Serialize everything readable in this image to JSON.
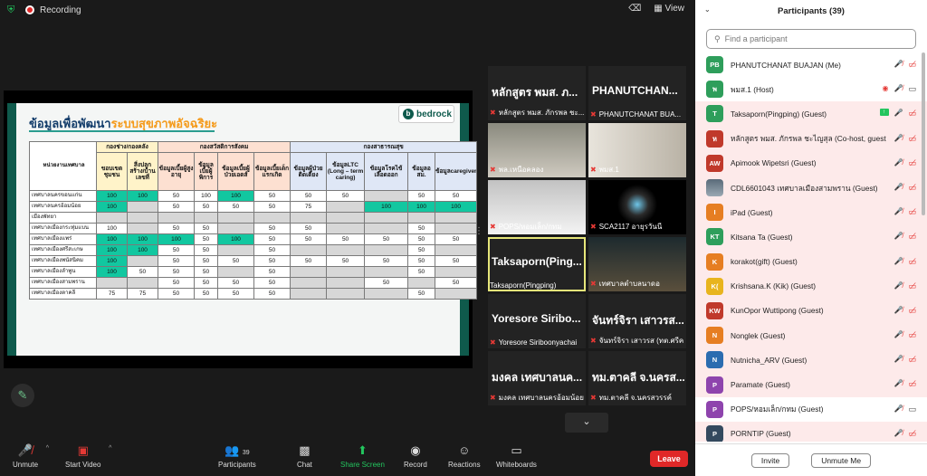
{
  "topbar": {
    "recording_label": "Recording",
    "view_label": "View"
  },
  "slide": {
    "title_part1": "ข้อมูลเพื่อพัฒนา",
    "title_part2": "ระบบสุขภาพอัจฉริยะ",
    "logo_text": "bedrock",
    "header_org": "หน่วยงานเทศบาล",
    "group_a": "กองช่าง/กองคลัง",
    "group_b": "กองสวัสดิการสังคม",
    "group_c": "กองสาธารณสุข",
    "columns": [
      "ขอบเขตชุมชน",
      "สิ่งปลูกสร้าง/บ้านเลขที่",
      "ข้อมูลเบี้ยผู้สูงอายุ",
      "ข้อมูลเบี้ยผู้พิการ",
      "ข้อมูลเบี้ยผู้ป่วยเอดส์",
      "ข้อมูลเบี้ยเด็กแรกเกิด",
      "ข้อมูลผู้ป่วยติดเตียง",
      "ข้อมูลLTC (Long – term caring)",
      "ข้อมูลโรคไข้เลือดออก",
      "ข้อมูลอสม.",
      "ข้อมูลcaregiver"
    ],
    "rows": [
      {
        "org": "เทศบาลนครขอนแก่น",
        "cells": [
          "100",
          "100",
          "50",
          "100",
          "100",
          "50",
          "50",
          "50",
          "",
          "50",
          "50"
        ]
      },
      {
        "org": "เทศบาลนครอ้อมน้อย",
        "cells": [
          "100",
          "",
          "50",
          "50",
          "50",
          "50",
          "75",
          "",
          "100",
          "100",
          "100"
        ]
      },
      {
        "org": "เมืองพัทยา",
        "cells": [
          "",
          "",
          "",
          "",
          "",
          "",
          "",
          "",
          "",
          "",
          ""
        ]
      },
      {
        "org": "เทศบาลเมืองกระทุ่มแบน",
        "cells": [
          "100",
          "",
          "50",
          "50",
          "",
          "50",
          "50",
          "",
          "",
          "50",
          ""
        ]
      },
      {
        "org": "เทศบาลเมืองแพร่",
        "cells": [
          "100",
          "100",
          "100",
          "50",
          "100",
          "50",
          "50",
          "50",
          "50",
          "50",
          "50"
        ]
      },
      {
        "org": "เทศบาลเมืองศรีสะเกษ",
        "cells": [
          "100",
          "100",
          "50",
          "50",
          "",
          "50",
          "",
          "",
          "",
          "50",
          ""
        ]
      },
      {
        "org": "เทศบาลเมืองพนัสนิคม",
        "cells": [
          "100",
          "",
          "50",
          "50",
          "50",
          "50",
          "50",
          "50",
          "50",
          "50",
          "50"
        ]
      },
      {
        "org": "เทศบาลเมืองลำพูน",
        "cells": [
          "100",
          "50",
          "50",
          "50",
          "",
          "50",
          "",
          "",
          "",
          "50",
          ""
        ]
      },
      {
        "org": "เทศบาลเมืองสามพราน",
        "cells": [
          "",
          "",
          "50",
          "50",
          "50",
          "50",
          "",
          "",
          "50",
          "",
          "50"
        ]
      },
      {
        "org": "เทศบาลเมืองตาคลี",
        "cells": [
          "75",
          "75",
          "50",
          "50",
          "50",
          "50",
          "",
          "",
          "",
          "50",
          ""
        ]
      }
    ],
    "green_cells": [
      [
        0,
        0
      ],
      [
        0,
        1
      ],
      [
        0,
        4
      ],
      [
        1,
        0
      ],
      [
        1,
        8
      ],
      [
        1,
        9
      ],
      [
        1,
        10
      ],
      [
        4,
        0
      ],
      [
        4,
        1
      ],
      [
        4,
        2
      ],
      [
        4,
        4
      ],
      [
        5,
        0
      ],
      [
        5,
        1
      ],
      [
        6,
        0
      ],
      [
        7,
        0
      ]
    ]
  },
  "videos": [
    {
      "big": "หลักสูตร พมส. ภ...",
      "label": "หลักสูตร พมส. ภักรพล ชะ..."
    },
    {
      "big": "PHANUTCHAN...",
      "label": "PHANUTCHANAT BUA..."
    },
    {
      "big": "",
      "label": "พล.เหนือคลอง"
    },
    {
      "big": "",
      "label": "พมส.1"
    },
    {
      "big": "",
      "label": "POPS/หอมเล็ก/กทม"
    },
    {
      "big": "",
      "label": "SCA2117 อายุรวันนี"
    },
    {
      "big": "Taksaporn(Ping...",
      "label": "Taksaporn(Pingping)"
    },
    {
      "big": "",
      "label": "เทศบาลตำบลนาดอ"
    },
    {
      "big": "Yoresore Siribo...",
      "label": "Yoresore Siriboonyachai"
    },
    {
      "big": "จันทร์จิรา เสาวรส...",
      "label": "จันทร์จิรา เสาวรส (ทต.ศรีค..."
    },
    {
      "big": "มงคล เทศบาลนค...",
      "label": "มงคล เทศบาลนครอ้อมน้อย"
    },
    {
      "big": "ทม.ตาคลี จ.นครส...",
      "label": "ทม.ตาคลี จ.นครสวรรค์"
    }
  ],
  "toolbar": {
    "mute": "Unmute",
    "video": "Start Video",
    "participants": "Participants",
    "participants_count": "39",
    "chat": "Chat",
    "share": "Share Screen",
    "record": "Record",
    "reactions": "Reactions",
    "whiteboards": "Whiteboards",
    "leave": "Leave"
  },
  "panel": {
    "title": "Participants (39)",
    "search_placeholder": "Find a participant",
    "invite": "Invite",
    "unmute_me": "Unmute Me",
    "participants": [
      {
        "initials": "PB",
        "color": "#2e9e5b",
        "name": "PHANUTCHANAT BUAJAN (Me)",
        "mic": "muted",
        "cam": "off"
      },
      {
        "initials": "พ",
        "color": "#2e9e5b",
        "name": "พมส.1 (Host)",
        "mic": "muted",
        "cam": "on",
        "rec": true
      },
      {
        "initials": "T",
        "color": "#2e9e5b",
        "name": "Taksaporn(Pingping) (Guest)",
        "mic": "on",
        "cam": "off",
        "share": true,
        "hl": true
      },
      {
        "initials": "ห",
        "color": "#c0392b",
        "name": "หลักสูตร พมส. ภักรพล ชะไญสุล (Co-host, guest)",
        "mic": "muted",
        "cam": "off",
        "hl": true
      },
      {
        "initials": "AW",
        "color": "#c0392b",
        "name": "Apimook Wipetsri (Guest)",
        "mic": "muted",
        "cam": "off",
        "hl": true
      },
      {
        "initials": "",
        "color": "#777",
        "name": "CDL6601043 เทศบาลเมืองสามพราน (Guest)",
        "mic": "muted",
        "cam": "off",
        "photo": true,
        "hl": true
      },
      {
        "initials": "I",
        "color": "#e67e22",
        "name": "iPad (Guest)",
        "mic": "muted",
        "cam": "off",
        "hl": true
      },
      {
        "initials": "KT",
        "color": "#2e9e5b",
        "name": "Kitsana Ta (Guest)",
        "mic": "muted",
        "cam": "off",
        "hl": true
      },
      {
        "initials": "K",
        "color": "#e67e22",
        "name": "korakot(gift) (Guest)",
        "mic": "muted",
        "cam": "off",
        "hl": true
      },
      {
        "initials": "K(",
        "color": "#e8b41e",
        "name": "Krishsana.K (Kik) (Guest)",
        "mic": "muted",
        "cam": "off",
        "hl": true
      },
      {
        "initials": "KW",
        "color": "#c0392b",
        "name": "KunOpor Wuttipong (Guest)",
        "mic": "muted",
        "cam": "off",
        "hl": true
      },
      {
        "initials": "N",
        "color": "#e67e22",
        "name": "Nonglek (Guest)",
        "mic": "muted",
        "cam": "off",
        "hl": true
      },
      {
        "initials": "N",
        "color": "#2b6cb0",
        "name": "Nutnicha_ARV (Guest)",
        "mic": "muted",
        "cam": "off",
        "hl": true
      },
      {
        "initials": "P",
        "color": "#8e44ad",
        "name": "Paramate (Guest)",
        "mic": "muted",
        "cam": "off",
        "hl": true
      },
      {
        "initials": "P",
        "color": "#8e44ad",
        "name": "POPS/หอมเล็ก/กทม (Guest)",
        "mic": "muted",
        "cam": "on",
        "hl": false
      },
      {
        "initials": "P",
        "color": "#34495e",
        "name": "PORNTIP (Guest)",
        "mic": "muted",
        "cam": "off",
        "hl": true
      }
    ]
  }
}
